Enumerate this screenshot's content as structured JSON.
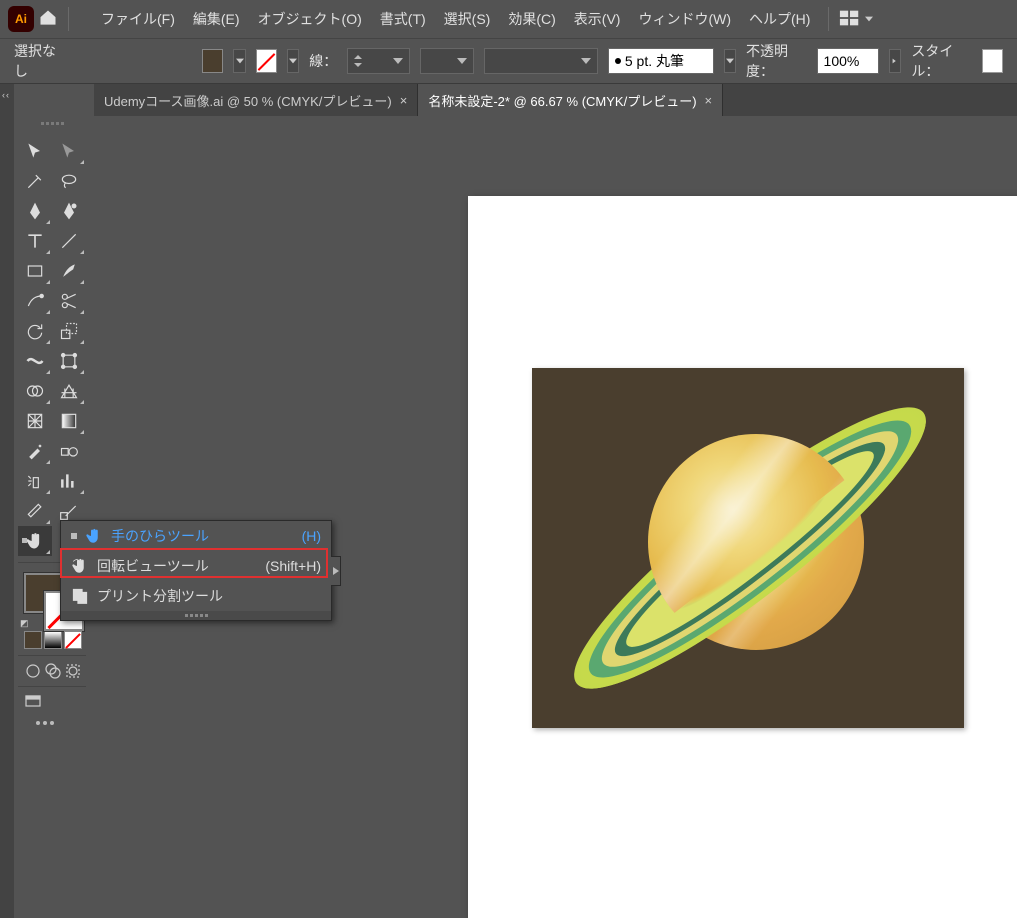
{
  "menubar": {
    "logo": "Ai",
    "items": [
      "ファイル(F)",
      "編集(E)",
      "オブジェクト(O)",
      "書式(T)",
      "選択(S)",
      "効果(C)",
      "表示(V)",
      "ウィンドウ(W)",
      "ヘルプ(H)"
    ]
  },
  "options": {
    "selection": "選択なし",
    "stroke_label": "線：",
    "stroke_weight": "",
    "brush": "5 pt. 丸筆",
    "opacity_label": "不透明度：",
    "opacity_value": "100%",
    "style_label": "スタイル："
  },
  "tabs": [
    {
      "label": "Udemyコース画像.ai @ 50 % (CMYK/プレビュー)",
      "active": false
    },
    {
      "label": "名称未設定-2* @ 66.67 % (CMYK/プレビュー)",
      "active": true
    }
  ],
  "flyout": {
    "items": [
      {
        "icon": "hand-icon",
        "label": "手のひらツール",
        "shortcut": "(H)",
        "selected": true
      },
      {
        "icon": "rotate-view-icon",
        "label": "回転ビューツール",
        "shortcut": "(Shift+H)",
        "highlighted": true
      },
      {
        "icon": "print-tile-icon",
        "label": "プリント分割ツール",
        "shortcut": ""
      }
    ]
  },
  "colors": {
    "fill": "#4a3e2e",
    "stroke": "none",
    "background": "#4a3e2e"
  }
}
